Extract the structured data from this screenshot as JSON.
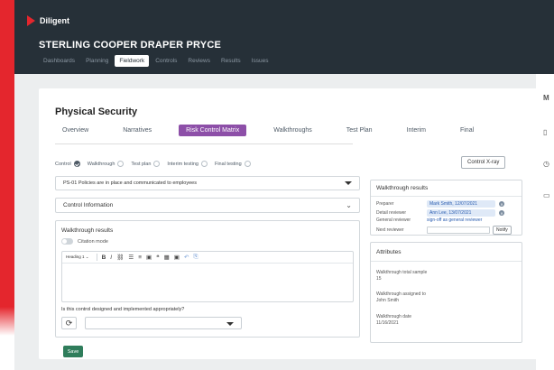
{
  "app": {
    "brand": "Diligent",
    "org_name": "STERLING COOPER DRAPER PRYCE"
  },
  "nav": {
    "items": [
      {
        "label": "Dashboards",
        "active": false
      },
      {
        "label": "Planning",
        "active": false
      },
      {
        "label": "Fieldwork",
        "active": true
      },
      {
        "label": "Controls",
        "active": false
      },
      {
        "label": "Reviews",
        "active": false
      },
      {
        "label": "Results",
        "active": false
      },
      {
        "label": "Issues",
        "active": false
      }
    ]
  },
  "page": {
    "title": "Physical Security",
    "tabs": [
      {
        "label": "Overview",
        "active": false
      },
      {
        "label": "Narratives",
        "active": false
      },
      {
        "label": "Risk Control Matrix",
        "active": true
      },
      {
        "label": "Walkthroughs",
        "active": false
      },
      {
        "label": "Test Plan",
        "active": false
      },
      {
        "label": "Interim",
        "active": false
      },
      {
        "label": "Final",
        "active": false
      }
    ]
  },
  "filters": {
    "items": [
      {
        "label": "Control",
        "checked": true
      },
      {
        "label": "Walkthrough",
        "checked": false
      },
      {
        "label": "Test plan",
        "checked": false
      },
      {
        "label": "Interim testing",
        "checked": false
      },
      {
        "label": "Final testing",
        "checked": false
      }
    ],
    "xray_label": "Control X-ray"
  },
  "control": {
    "policy_value": "PS-01 Policies are in place and communicated to employees",
    "info_label": "Control Information"
  },
  "walkthrough": {
    "title": "Walkthrough results",
    "citation_label": "Citation mode",
    "toolbar": {
      "heading": "Heading 1",
      "bold": "B",
      "italic": "I",
      "link": "⛓",
      "bullets": "☰",
      "numbers": "≡",
      "image": "▣",
      "quote": "❝",
      "table": "▦",
      "more": "▣",
      "undo": "↶",
      "redo": "⎘"
    },
    "question": "Is this control designed and implemented appropriately?",
    "save_label": "Save"
  },
  "results_panel": {
    "title": "Walkthrough results",
    "rows": [
      {
        "label": "Preparer",
        "value": "Mark Smith, 12/07/2021"
      },
      {
        "label": "Detail reviewer",
        "value": "Ann Lee, 13/07/2021"
      },
      {
        "label": "General reviewer",
        "value": "sign-off as general reviewer"
      },
      {
        "label": "Next reviewer",
        "notify": "Notify"
      }
    ]
  },
  "attributes": {
    "title": "Attributes",
    "items": [
      {
        "label": "Walkthrough total sample",
        "value": "15"
      },
      {
        "label": "Walkthrough assigned to",
        "value": "John Smith"
      },
      {
        "label": "Walkthrough date",
        "value": "11/16/2021"
      }
    ]
  },
  "right_edge": {
    "letter": "M"
  },
  "colors": {
    "brand_red": "#e4262d",
    "header": "#263038",
    "tab_active": "#8d4fa8",
    "save_green": "#2f7d5b",
    "chip_blue": "#dfe9f7"
  }
}
